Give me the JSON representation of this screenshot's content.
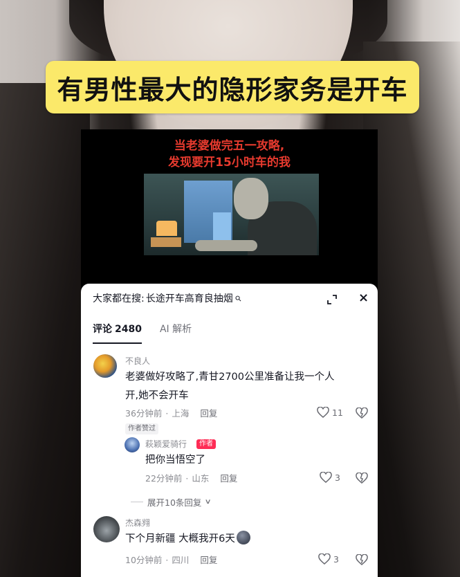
{
  "title_banner": "有男性最大的隐形家务是开车",
  "video": {
    "caption_line1": "当老婆做完五一攻略,",
    "caption_line2": "发现要开15小时车的我"
  },
  "panel": {
    "search_prefix": "大家都在搜:",
    "search_query": "长途开车高育良抽烟",
    "tabs": [
      {
        "label": "评论",
        "count": "2480"
      },
      {
        "label": "AI 解析"
      }
    ]
  },
  "comments": [
    {
      "username": "不良人",
      "text_line1": "老婆做好攻略了,青甘2700公里准备让我一个人",
      "text_line2": "开,她不会开车",
      "time": "36分钟前",
      "location": "上海",
      "reply_label": "回复",
      "likes": "11",
      "badge": "作者赞过"
    },
    {
      "username": "萩颖爱骑行",
      "author_tag": "作者",
      "text": "把你当悟空了",
      "time": "22分钟前",
      "location": "山东",
      "reply_label": "回复",
      "likes": "3"
    },
    {
      "username": "杰森翙",
      "text": "下个月新疆 大概我开6天",
      "time": "10分钟前",
      "location": "四川",
      "reply_label": "回复",
      "likes": "3"
    }
  ],
  "expand_replies_label": "展开10条回复",
  "icons": {
    "search": "search-icon",
    "expand": "expand-icon",
    "close": "close-icon",
    "heart": "heart-icon",
    "dislike": "dislike-icon",
    "chevron": "chevron-down-icon"
  },
  "colors": {
    "banner_bg": "#fbe96a",
    "caption_red": "#e63a2e",
    "author_tag": "#fe2c55"
  }
}
